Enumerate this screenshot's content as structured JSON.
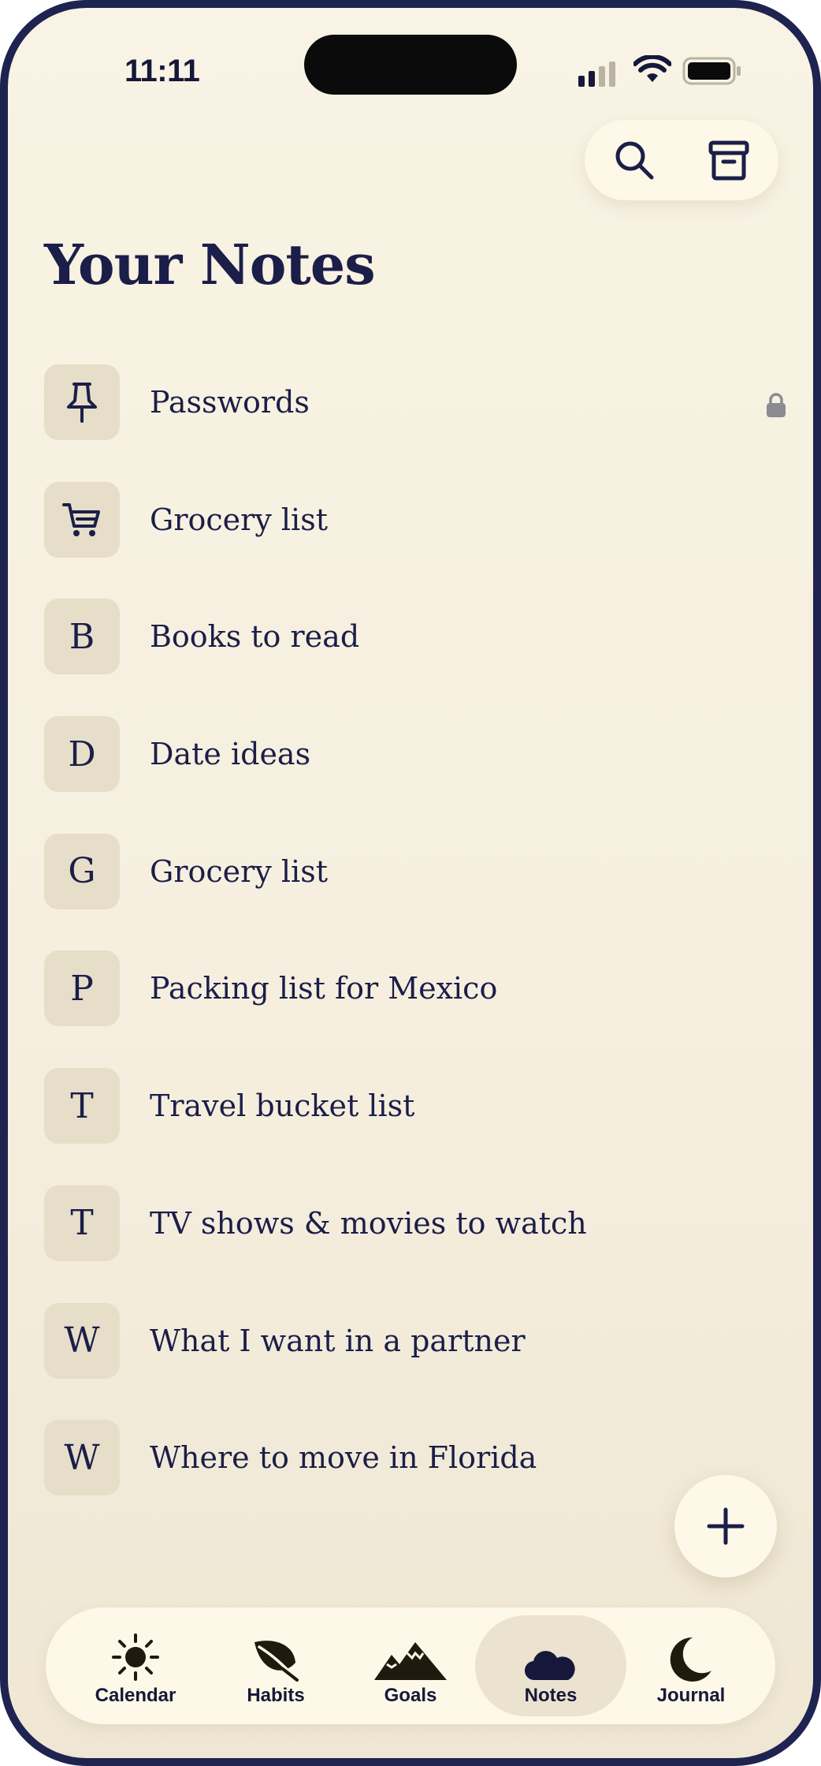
{
  "status_bar": {
    "time": "11:11",
    "signal_bars_active": 2,
    "signal_bars_total": 4
  },
  "toolbar": {
    "search_icon": "search-icon",
    "archive_icon": "archive-icon"
  },
  "page": {
    "title": "Your Notes"
  },
  "notes": [
    {
      "badge_icon": "pin-icon",
      "badge_text": "",
      "title": "Passwords",
      "locked": true
    },
    {
      "badge_icon": "cart-icon",
      "badge_text": "",
      "title": "Grocery list",
      "locked": false
    },
    {
      "badge_icon": "",
      "badge_text": "B",
      "title": "Books to read",
      "locked": false
    },
    {
      "badge_icon": "",
      "badge_text": "D",
      "title": "Date ideas",
      "locked": false
    },
    {
      "badge_icon": "",
      "badge_text": "G",
      "title": "Grocery list",
      "locked": false
    },
    {
      "badge_icon": "",
      "badge_text": "P",
      "title": "Packing list for Mexico",
      "locked": false
    },
    {
      "badge_icon": "",
      "badge_text": "T",
      "title": "Travel bucket list",
      "locked": false
    },
    {
      "badge_icon": "",
      "badge_text": "T",
      "title": "TV shows & movies to watch",
      "locked": false
    },
    {
      "badge_icon": "",
      "badge_text": "W",
      "title": "What I want in a partner",
      "locked": false
    },
    {
      "badge_icon": "",
      "badge_text": "W",
      "title": "Where to move in Florida",
      "locked": false
    }
  ],
  "fab": {
    "icon": "plus-icon"
  },
  "tab_bar": {
    "active": "Notes",
    "tabs": [
      {
        "label": "Calendar",
        "icon": "sun-icon"
      },
      {
        "label": "Habits",
        "icon": "leaf-icon"
      },
      {
        "label": "Goals",
        "icon": "mountain-icon"
      },
      {
        "label": "Notes",
        "icon": "cloud-icon"
      },
      {
        "label": "Journal",
        "icon": "moon-icon"
      }
    ]
  },
  "colors": {
    "ink": "#1b1e48",
    "background": "#f8f3e4",
    "badge": "#e6dec9",
    "surface": "#fdf8e7",
    "frame": "#1f2350"
  }
}
